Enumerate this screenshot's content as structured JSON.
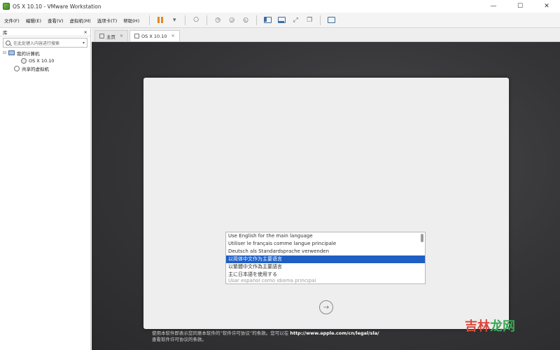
{
  "window": {
    "title": "OS X 10.10 - VMware Workstation",
    "minimize": "—",
    "maximize": "☐",
    "close": "✕"
  },
  "menu": [
    "文件(F)",
    "编辑(E)",
    "查看(V)",
    "虚拟机(M)",
    "选项卡(T)",
    "帮助(H)"
  ],
  "library": {
    "title": "库",
    "close": "×",
    "search_placeholder": "在此处键入内容进行搜索",
    "tree": {
      "my_computer": "我的计算机",
      "vm": "OS X 10.10",
      "shared": "共享的虚拟机"
    }
  },
  "tabs": [
    {
      "label": "主页",
      "close": "×"
    },
    {
      "label": "OS X 10.10",
      "close": "×"
    }
  ],
  "setup": {
    "languages": [
      "Use English for the main language",
      "Utiliser le français comme langue principale",
      "Deutsch als Standardsprache verwenden",
      "以简体中文作为主要语言",
      "以繁體中文作為主要語言",
      "主に日本語を使用する",
      "Usar español como idioma principal"
    ],
    "selected_index": 3,
    "next_arrow": "→",
    "license_line1": "使用本软件即表示您同意本软件的“软件许可协议”的条款。您可以在",
    "license_url": "http://www.apple.com/cn/legal/sla/",
    "license_line2": "查看软件许可协议的条款。"
  },
  "watermark": {
    "part1": "吉林",
    "part2": "龙网"
  },
  "colors": {
    "selection": "#1e5fc4",
    "pause": "#e08a1e"
  }
}
